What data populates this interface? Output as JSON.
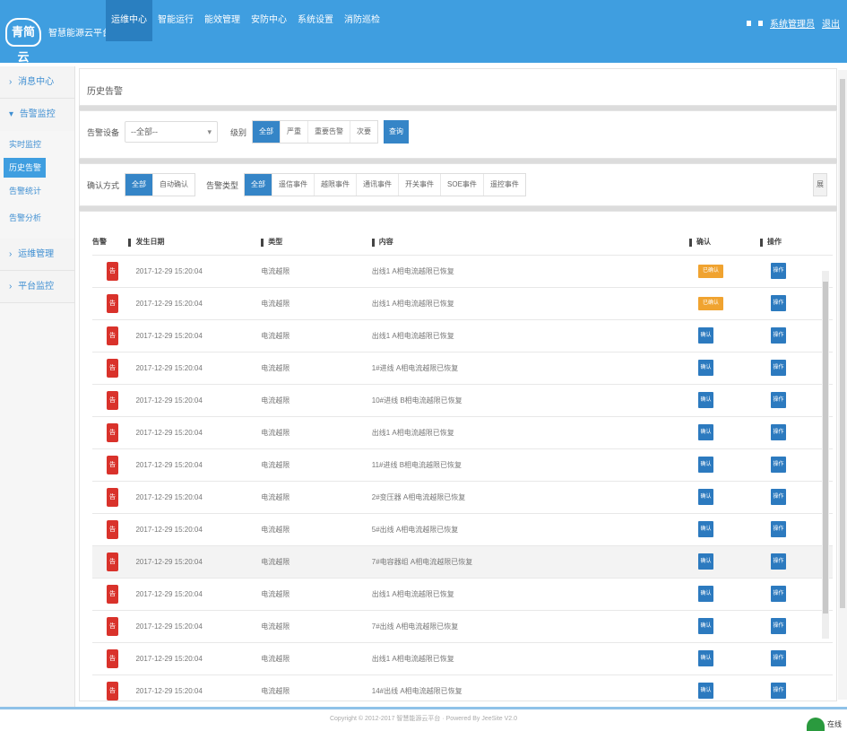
{
  "header": {
    "logo_text": "青简云",
    "brand": "智慧能源云平台",
    "nav": [
      "运维中心",
      "智能运行",
      "能效管理",
      "安防中心",
      "系统设置",
      "消防巡检"
    ],
    "active_nav": 0,
    "right_links": [
      "退出",
      "系统管理员"
    ],
    "logout": "退出"
  },
  "sidebar": {
    "groups": [
      {
        "label": "消息中心",
        "expanded": false
      },
      {
        "label": "告警监控",
        "expanded": true,
        "children": [
          "实时监控",
          "历史告警",
          "告警统计",
          "告警分析"
        ],
        "active_child": 1
      },
      {
        "label": "运维管理",
        "expanded": false
      },
      {
        "label": "平台监控",
        "expanded": false
      }
    ]
  },
  "main": {
    "page_title": "历史告警",
    "filter1": {
      "label1": "告警设备",
      "select_value": "--全部--",
      "label2": "级别",
      "levels": [
        "全部",
        "严重",
        "重要告警",
        "次要"
      ],
      "level_active": 0,
      "confirm": "查询"
    },
    "filter2": {
      "label1": "确认方式",
      "confirm_types": [
        "全部",
        "自动确认"
      ],
      "confirm_active": 0,
      "label2": "告警类型",
      "types": [
        "全部",
        "遥信事件",
        "越限事件",
        "通讯事件",
        "开关事件",
        "SOE事件",
        "遥控事件"
      ],
      "types_active": 0,
      "expand_btn": "展"
    },
    "table": {
      "columns": [
        "告警",
        "发生日期",
        "类型",
        "内容",
        "确认",
        "操作"
      ],
      "rows": [
        {
          "date": "2017-12-29 15:20:04",
          "type": "电流越限",
          "content": "出线1 A相电流越限已恢复",
          "confirm": "已确认",
          "confirmed": true
        },
        {
          "date": "2017-12-29 15:20:04",
          "type": "电流越限",
          "content": "出线1 A相电流越限已恢复",
          "confirm": "已确认",
          "confirmed": true
        },
        {
          "date": "2017-12-29 15:20:04",
          "type": "电流越限",
          "content": "出线1 A相电流越限已恢复",
          "confirm": "确认",
          "confirmed": false
        },
        {
          "date": "2017-12-29 15:20:04",
          "type": "电流越限",
          "content": "1#进线 A相电流越限已恢复",
          "confirm": "确认",
          "confirmed": false
        },
        {
          "date": "2017-12-29 15:20:04",
          "type": "电流越限",
          "content": "10#进线 B相电流越限已恢复",
          "confirm": "确认",
          "confirmed": false
        },
        {
          "date": "2017-12-29 15:20:04",
          "type": "电流越限",
          "content": "出线1 A相电流越限已恢复",
          "confirm": "确认",
          "confirmed": false
        },
        {
          "date": "2017-12-29 15:20:04",
          "type": "电流越限",
          "content": "11#进线 B相电流越限已恢复",
          "confirm": "确认",
          "confirmed": false
        },
        {
          "date": "2017-12-29 15:20:04",
          "type": "电流越限",
          "content": "2#变压器 A相电流越限已恢复",
          "confirm": "确认",
          "confirmed": false
        },
        {
          "date": "2017-12-29 15:20:04",
          "type": "电流越限",
          "content": "5#出线 A相电流越限已恢复",
          "confirm": "确认",
          "confirmed": false
        },
        {
          "date": "2017-12-29 15:20:04",
          "type": "电流越限",
          "content": "7#电容器组 A相电流越限已恢复",
          "confirm": "确认",
          "confirmed": false
        },
        {
          "date": "2017-12-29 15:20:04",
          "type": "电流越限",
          "content": "出线1 A相电流越限已恢复",
          "confirm": "确认",
          "confirmed": false
        },
        {
          "date": "2017-12-29 15:20:04",
          "type": "电流越限",
          "content": "7#出线 A相电流越限已恢复",
          "confirm": "确认",
          "confirmed": false
        },
        {
          "date": "2017-12-29 15:20:04",
          "type": "电流越限",
          "content": "出线1 A相电流越限已恢复",
          "confirm": "确认",
          "confirmed": false
        },
        {
          "date": "2017-12-29 15:20:04",
          "type": "电流越限",
          "content": "14#出线 A相电流越限已恢复",
          "confirm": "确认",
          "confirmed": false
        }
      ],
      "alarm_icon": "告",
      "op_label": "操作",
      "highlight_row": 9
    }
  },
  "footer": {
    "text": "Copyright © 2012-2017 智慧能源云平台 · Powered By JeeSite V2.0"
  },
  "chat": {
    "label": "在线"
  }
}
